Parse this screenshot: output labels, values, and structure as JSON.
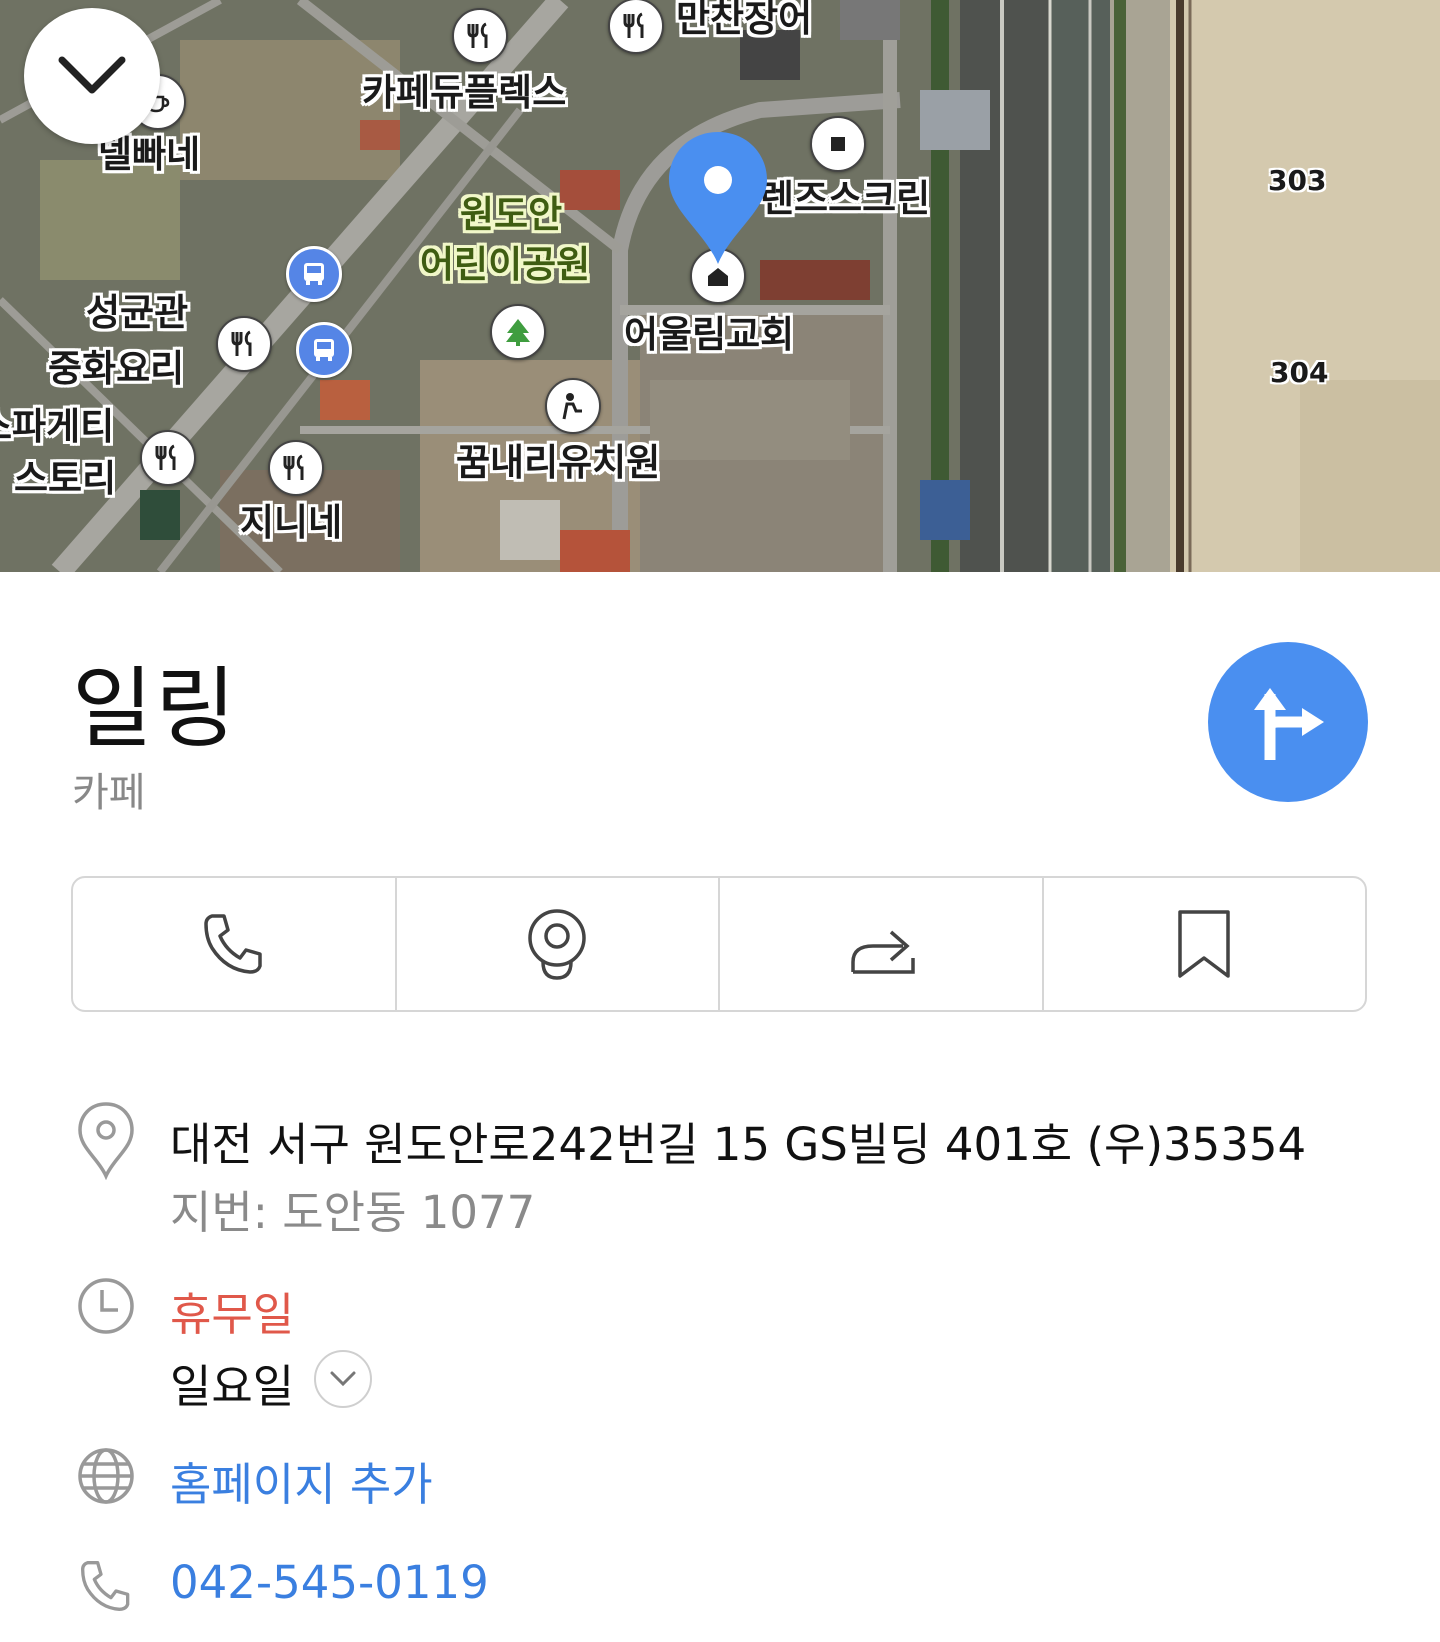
{
  "map": {
    "labels": {
      "manchan": "만찬장어",
      "cafe_duplex": "카페듀플렉스",
      "delppane": "델빠네",
      "friends_screen": "렌즈스크린",
      "park_line1": "원도안",
      "park_line2": "어린이공원",
      "seonggyungwan_line1": "성균관",
      "seonggyungwan_line2": "중화요리",
      "church": "어울림교회",
      "spaghetti_line1": "스파게티",
      "spaghetti_line2": "스토리",
      "kindergarten": "꿈내리유치원",
      "jinine": "지니네"
    },
    "road_numbers": {
      "r303": "303",
      "r304": "304"
    }
  },
  "place": {
    "name": "일링",
    "category": "카페"
  },
  "actions": {
    "call": "call-icon",
    "roadview": "roadview-icon",
    "share": "share-icon",
    "save": "bookmark-icon"
  },
  "address": {
    "road": "대전 서구 원도안로242번길 15 GS빌딩 401호 (우)35354",
    "lot": "지번: 도안동 1077"
  },
  "hours": {
    "status": "휴무일",
    "day": "일요일"
  },
  "homepage": {
    "label": "홈페이지 추가"
  },
  "phone": {
    "number": "042-545-0119"
  },
  "colors": {
    "accent": "#4a8ff0",
    "link": "#3a7fe0",
    "closed": "#e0584a"
  }
}
